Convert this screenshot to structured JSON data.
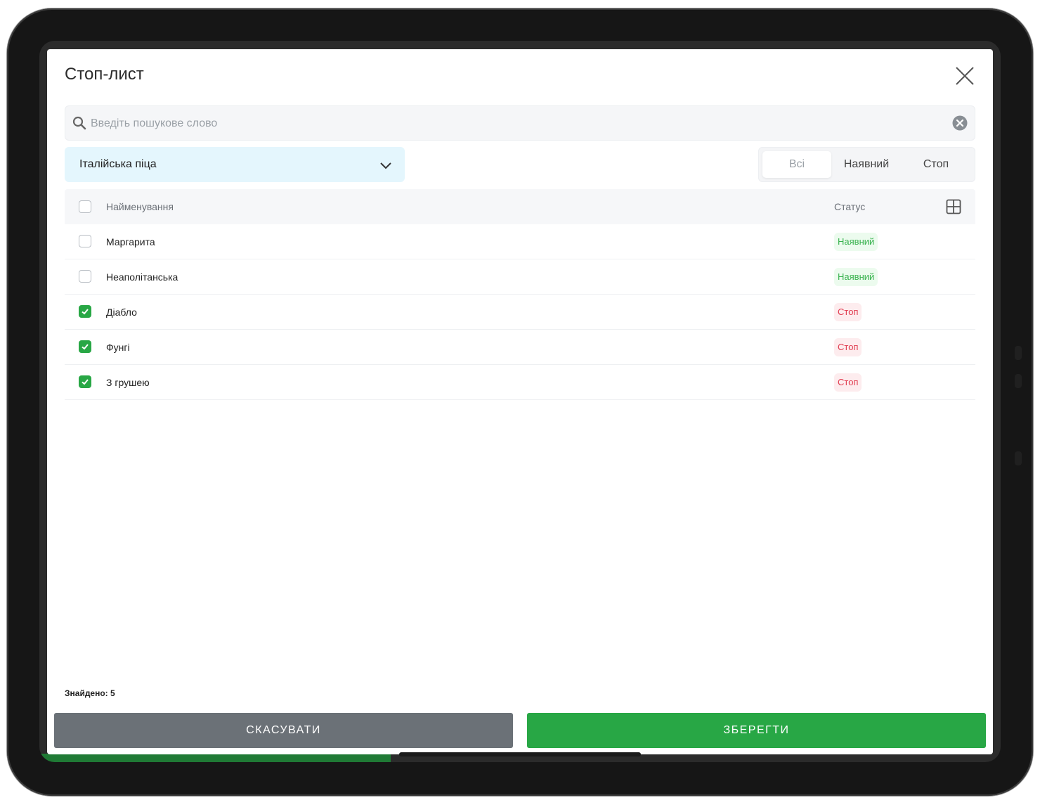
{
  "modal": {
    "title": "Стоп-лист"
  },
  "search": {
    "placeholder": "Введіть пошукове слово"
  },
  "category": {
    "selected": "Італійська піца"
  },
  "filter": {
    "options": [
      "Всі",
      "Наявний",
      "Стоп"
    ],
    "active": "Всі"
  },
  "table": {
    "headers": {
      "name": "Найменування",
      "status": "Статус"
    },
    "rows": [
      {
        "name": "Маргарита",
        "status": "Наявний",
        "checked": false
      },
      {
        "name": "Неаполітанська",
        "status": "Наявний",
        "checked": false
      },
      {
        "name": "Діабло",
        "status": "Стоп",
        "checked": true
      },
      {
        "name": "Фунгі",
        "status": "Стоп",
        "checked": true
      },
      {
        "name": "З грушею",
        "status": "Стоп",
        "checked": true
      }
    ]
  },
  "footer": {
    "found": "Знайдено: 5",
    "cancel_label": "СКАСУВАТИ",
    "save_label": "ЗБЕРЕГТИ"
  },
  "colors": {
    "accent_green": "#28a745",
    "cancel_gray": "#6b7177",
    "status_available": "#37b24d",
    "status_stop": "#e03a4e",
    "category_bg": "#e4f6fd"
  }
}
